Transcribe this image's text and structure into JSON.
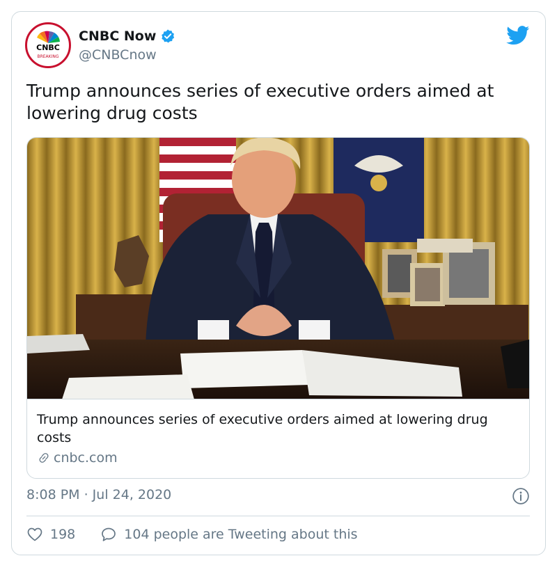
{
  "account": {
    "display_name": "CNBC Now",
    "handle": "@CNBCnow",
    "avatar_logo_text": "CNBC",
    "avatar_sub_text": "BREAKING",
    "verified_icon": "verified-badge-icon",
    "platform_icon": "twitter-bird-icon"
  },
  "tweet": {
    "text": "Trump announces series of executive orders aimed at lowering drug costs",
    "timestamp": "8:08 PM · Jul 24, 2020"
  },
  "card": {
    "title": "Trump announces series of executive orders aimed at lowering drug costs",
    "domain": "cnbc.com",
    "link_icon": "link-icon"
  },
  "engagement": {
    "likes": "198",
    "replies_text": "104 people are Tweeting about this",
    "like_icon": "heart-icon",
    "reply_icon": "speech-bubble-icon",
    "info_icon": "info-icon"
  },
  "colors": {
    "brand_blue": "#1da1f2",
    "text": "#14171a",
    "muted": "#657786",
    "border": "#cfd9de",
    "cnbc_red": "#c8102e"
  }
}
